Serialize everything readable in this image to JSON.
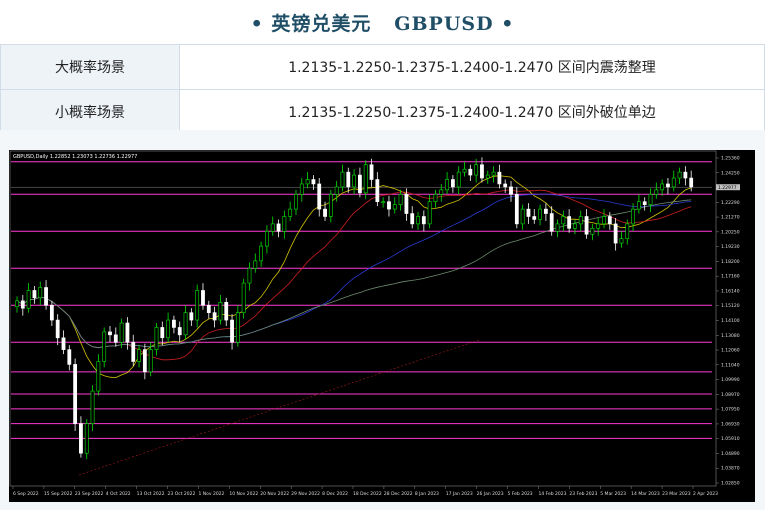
{
  "title": "• 英镑兑美元   GBPUSD •",
  "table": {
    "rows": [
      {
        "label": "大概率场景",
        "value": "1.2135-1.2250-1.2375-1.2400-1.2470 区间内震荡整理"
      },
      {
        "label": "小概率场景",
        "value": "1.2135-1.2250-1.2375-1.2400-1.2470 区间外破位单边"
      }
    ]
  },
  "chart_data": {
    "type": "candlestick",
    "symbol_header": "GBPUSD,Daily  1.22852 1.23073 1.22736 1.22977",
    "price_ticks": [
      "1.25360",
      "1.24250",
      "1.23310",
      "1.22290",
      "1.21270",
      "1.20250",
      "1.19230",
      "1.18200",
      "1.17160",
      "1.16140",
      "1.15120",
      "1.14100",
      "1.13080",
      "1.12060",
      "1.11040",
      "1.09990",
      "1.08970",
      "1.07950",
      "1.06930",
      "1.05910",
      "1.04890",
      "1.03870",
      "1.02850"
    ],
    "current_price": "1.22977",
    "x_ticks": [
      "6 Sep 2022",
      "15 Sep 2022",
      "23 Sep 2022",
      "4 Oct 2022",
      "13 Oct 2022",
      "23 Oct 2022",
      "1 Nov 2022",
      "10 Nov 2022",
      "20 Nov 2022",
      "29 Nov 2022",
      "8 Dec 2022",
      "18 Dec 2022",
      "28 Dec 2022",
      "8 Jan 2023",
      "17 Jan 2023",
      "26 Jan 2023",
      "5 Feb 2023",
      "14 Feb 2023",
      "23 Feb 2023",
      "5 Mar 2023",
      "14 Mar 2023",
      "23 Mar 2023",
      "2 Apr 2023"
    ],
    "ylim": [
      1.0285,
      1.2536
    ],
    "horizontal_levels": [
      1.247,
      1.225,
      1.2,
      1.175,
      1.15,
      1.125,
      1.105,
      1.09,
      1.08,
      1.07,
      1.06
    ],
    "closes": [
      1.153,
      1.148,
      1.16,
      1.155,
      1.162,
      1.15,
      1.14,
      1.128,
      1.12,
      1.11,
      1.07,
      1.05,
      1.07,
      1.092,
      1.112,
      1.132,
      1.13,
      1.125,
      1.138,
      1.125,
      1.112,
      1.12,
      1.105,
      1.12,
      1.135,
      1.128,
      1.14,
      1.135,
      1.13,
      1.145,
      1.14,
      1.16,
      1.15,
      1.145,
      1.14,
      1.152,
      1.14,
      1.125,
      1.145,
      1.165,
      1.175,
      1.18,
      1.19,
      1.2,
      1.205,
      1.2,
      1.21,
      1.215,
      1.225,
      1.232,
      1.235,
      1.232,
      1.215,
      1.21,
      1.225,
      1.23,
      1.24,
      1.23,
      1.238,
      1.226,
      1.245,
      1.235,
      1.22,
      1.22,
      1.215,
      1.218,
      1.225,
      1.212,
      1.205,
      1.21,
      1.205,
      1.22,
      1.225,
      1.228,
      1.235,
      1.23,
      1.24,
      1.242,
      1.238,
      1.245,
      1.236,
      1.238,
      1.24,
      1.232,
      1.23,
      1.225,
      1.205,
      1.215,
      1.21,
      1.208,
      1.215,
      1.212,
      1.2,
      1.205,
      1.21,
      1.202,
      1.205,
      1.21,
      1.198,
      1.202,
      1.205,
      1.21,
      1.205,
      1.192,
      1.195,
      1.205,
      1.215,
      1.22,
      1.218,
      1.225,
      1.228,
      1.232,
      1.23,
      1.236,
      1.24,
      1.236,
      1.23
    ]
  }
}
